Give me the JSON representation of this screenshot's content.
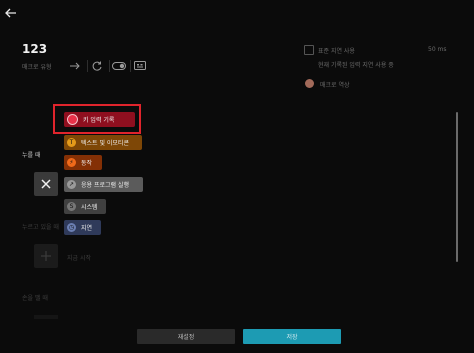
{
  "header": {
    "back_glyph": "←",
    "title": "123",
    "top_glyph": "ˆ"
  },
  "macro_type": {
    "label": "매크로 유형",
    "options": [
      {
        "icon": "arrow-right-icon",
        "glyph": "→"
      },
      {
        "icon": "repeat-icon",
        "glyph": "↻"
      },
      {
        "icon": "toggle-icon",
        "glyph": ""
      },
      {
        "icon": "keyboard-macro-icon",
        "glyph": "⌨"
      }
    ]
  },
  "delay_settings": {
    "use_delay_label": "표준 지연 사용",
    "value_text": "50 ms",
    "description": "현재 기록된 입력 지연 사용 중",
    "macro_effect_label": "매크로 역상"
  },
  "sections": {
    "on_press": "누를 때",
    "while_holding": "누르고 있을 때",
    "add_step": "지금 시작",
    "on_release": "손을 뗄 때"
  },
  "action_menu": {
    "items": [
      {
        "label": "키 입력 기록",
        "icon": "record-icon",
        "glyph": "",
        "color": "#8f0f1f",
        "icon_bg": "#e8324a"
      },
      {
        "label": "텍스트 및 이모티콘",
        "icon": "text-emoji-icon",
        "glyph": "T",
        "color": "#7e4706",
        "icon_bg": "#e39a1a"
      },
      {
        "label": "동작",
        "icon": "action-icon",
        "glyph": "⚡",
        "color": "#843005",
        "icon_bg": "#f06a1a"
      },
      {
        "label": "응용 프로그램 실행",
        "icon": "launch-app-icon",
        "glyph": "↗",
        "color": "#5b5b5b",
        "icon_bg": "#9a9a9a"
      },
      {
        "label": "시스템",
        "icon": "system-icon",
        "glyph": "S",
        "color": "#404040",
        "icon_bg": "#777777"
      },
      {
        "label": "지연",
        "icon": "delay-icon",
        "glyph": "◷",
        "color": "#2f3a5a",
        "icon_bg": "#6b7fb3"
      }
    ]
  },
  "footer": {
    "reset_label": "재설정",
    "save_label": "저장"
  },
  "colors": {
    "accent": "#1d9bb3",
    "highlight": "#e0242c"
  }
}
